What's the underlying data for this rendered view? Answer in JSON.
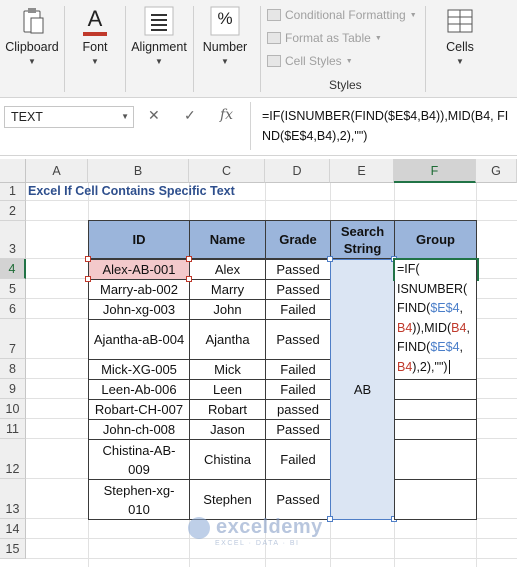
{
  "ribbon": {
    "clipboard_label": "Clipboard",
    "font_label": "Font",
    "alignment_label": "Alignment",
    "number_label": "Number",
    "cells_label": "Cells",
    "styles_group_label": "Styles",
    "conditional_formatting": "Conditional Formatting",
    "format_as_table": "Format as Table",
    "cell_styles": "Cell Styles",
    "font_icon_letter": "A",
    "number_icon_glyph": "%"
  },
  "formula_bar": {
    "name_box": "TEXT",
    "cancel": "✕",
    "enter": "✓",
    "fx": "fx",
    "formula": "=IF(ISNUMBER(FIND($E$4,B4)),MID(B4, FIND($E$4,B4),2),\"\")"
  },
  "columns": [
    "A",
    "B",
    "C",
    "D",
    "E",
    "F",
    "G"
  ],
  "rows": [
    "1",
    "2",
    "3",
    "4",
    "5",
    "6",
    "7",
    "8",
    "9",
    "10",
    "11",
    "12",
    "13",
    "14",
    "15"
  ],
  "title": "Excel If Cell Contains Specific Text",
  "table": {
    "headers": {
      "id": "ID",
      "name": "Name",
      "grade": "Grade",
      "search": "Search String",
      "group": "Group"
    },
    "data": [
      {
        "id": "Alex-AB-001",
        "name": "Alex",
        "grade": "Passed"
      },
      {
        "id": "Marry-ab-002",
        "name": "Marry",
        "grade": "Passed"
      },
      {
        "id": "John-xg-003",
        "name": "John",
        "grade": "Failed"
      },
      {
        "id": "Ajantha-aB-004",
        "name": "Ajantha",
        "grade": "Passed"
      },
      {
        "id": "Mick-XG-005",
        "name": "Mick",
        "grade": "Failed"
      },
      {
        "id": "Leen-Ab-006",
        "name": "Leen",
        "grade": "Failed"
      },
      {
        "id": "Robart-CH-007",
        "name": "Robart",
        "grade": "passed"
      },
      {
        "id": "John-ch-008",
        "name": "Jason",
        "grade": "Passed"
      },
      {
        "id": "Chistina-AB-009",
        "name": "Chistina",
        "grade": "Failed"
      },
      {
        "id": "Stephen-xg-010",
        "name": "Stephen",
        "grade": "Passed"
      }
    ],
    "search_value": "AB"
  },
  "edit": {
    "l1": "=IF(",
    "l2": "ISNUMBER(",
    "l3a": "FIND(",
    "l3b": "$E$4",
    "l3c": ",",
    "l4a": "B4",
    "l4b": ")),MID(",
    "l4c": "B4",
    "l4d": ",",
    "l5a": "FIND(",
    "l5b": "$E$4",
    "l5c": ",",
    "l6a": "B4",
    "l6b": "),2),\"\")"
  },
  "watermark": {
    "brand": "exceldemy",
    "tagline": "EXCEL · DATA · BI"
  },
  "colors": {
    "header_fill": "#9bb5db",
    "selected_id": "#f3c9cb",
    "search_fill": "#dbe5f3",
    "accent": "#217346"
  }
}
